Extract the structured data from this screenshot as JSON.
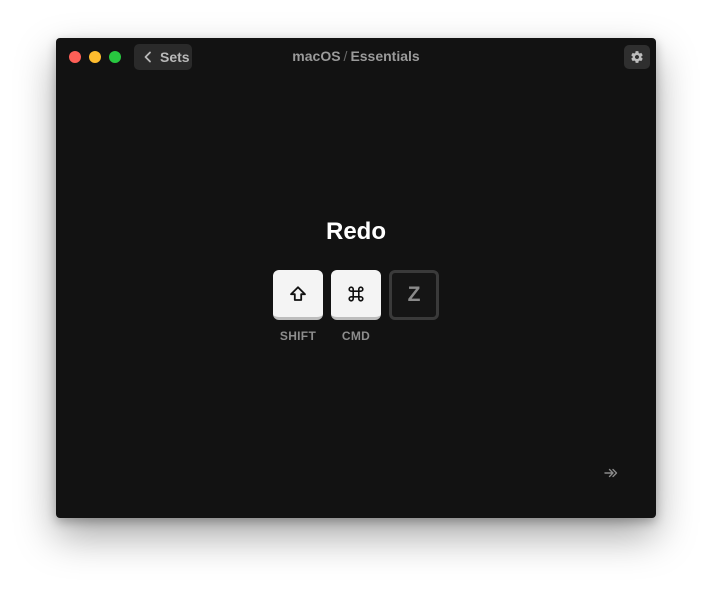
{
  "window": {
    "breadcrumb": {
      "platform": "macOS",
      "separator": "/",
      "set": "Essentials"
    },
    "back_label": "Sets",
    "settings_icon": "gear-icon"
  },
  "shortcut": {
    "action": "Redo",
    "keys": [
      {
        "glyph": "⇧",
        "label": "SHIFT",
        "state": "pressed"
      },
      {
        "glyph": "⌘",
        "label": "CMD",
        "state": "pressed"
      },
      {
        "glyph": "Z",
        "label": "",
        "state": "pending"
      }
    ]
  },
  "navigation": {
    "next_icon": "double-arrow-right-icon"
  },
  "colors": {
    "traffic_red": "#fe5f57",
    "traffic_yellow": "#febc2e",
    "traffic_green": "#28c840",
    "window_bg": "#121212"
  }
}
